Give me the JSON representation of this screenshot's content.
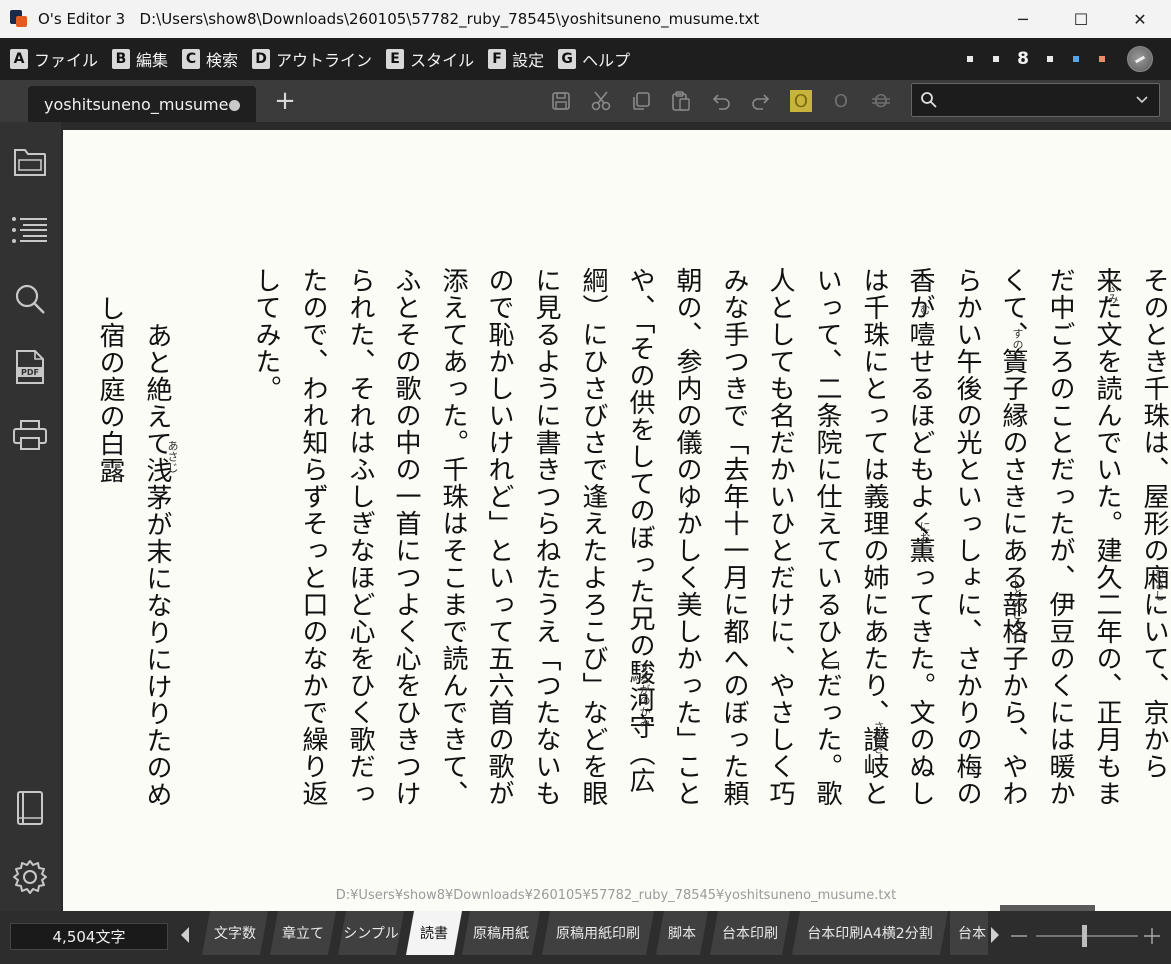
{
  "window": {
    "app_name": "O's Editor 3",
    "file_path": "D:\\Users\\show8\\Downloads\\260105\\57782_ruby_78545\\yoshitsuneno_musume.txt",
    "minimize": "─",
    "maximize": "☐",
    "close": "✕"
  },
  "menu": {
    "items": [
      {
        "key": "A",
        "label": "ファイル"
      },
      {
        "key": "B",
        "label": "編集"
      },
      {
        "key": "C",
        "label": "検索"
      },
      {
        "key": "D",
        "label": "アウトライン"
      },
      {
        "key": "E",
        "label": "スタイル"
      },
      {
        "key": "F",
        "label": "設定"
      },
      {
        "key": "G",
        "label": "ヘルプ"
      }
    ],
    "right_number": "8"
  },
  "tabs": {
    "active_tab_label": "yoshitsuneno_musume",
    "new_tab": "+"
  },
  "toolbar": {
    "icons": [
      "save-icon",
      "cut-icon",
      "copy-icon",
      "paste-icon",
      "undo-icon",
      "redo-icon",
      "bold-icon",
      "italic-icon",
      "strikethrough-icon"
    ],
    "search_placeholder": ""
  },
  "sidebar": {
    "icons": [
      "folder-icon",
      "outline-list-icon",
      "search-icon",
      "pdf-icon",
      "print-icon",
      "book-icon",
      "settings-icon"
    ]
  },
  "editor": {
    "columns": [
      "そのとき千珠は、屋形の廂にいて、京から",
      "来た文を読んでいた。建久二年の、正月もま",
      "だ中ごろのことだったが、伊豆のくには暖か",
      "くて、簀子縁のさきにある蔀格子から、やわ",
      "らかい午後の光といっしょに、さかりの梅の",
      "香が噎せるほどもよく薫ってきた。文のぬし",
      "は千珠にとっては義理の姉にあたり、讃岐と",
      "いって、二条院に仕えているひとだった。歌",
      "人としても名だかいひとだけに、やさしく巧",
      "みな手つきで「去年十一月に都へのぼった頼",
      "朝の、参内の儀のゆかしく美しかった」こと",
      "や、「その供をしてのぼった兄の駿河守（広",
      "綱）にひさびさで逢えたよろこび」などを眼",
      "に見るように書きつらねたうえ「つたないも",
      "ので恥かしいけれど」といって五六首の歌が",
      "添えてあった。千珠はそこまで読んできて、",
      "ふとその歌の中の一首につよく心をひきつけ",
      "られた、それはふしぎなほど心をひく歌だっ",
      "たので、われ知らずそっと口のなかで繰り返",
      "してみた。",
      "",
      "　あと絶えて浅茅が末になりにけりたのめ",
      "し宿の庭の白露"
    ],
    "ruby": [
      {
        "text": "ひさし"
      },
      {
        "text": "ふみ"
      },
      {
        "text": "すのこ"
      },
      {
        "text": "しとみごうし"
      },
      {
        "text": "む"
      },
      {
        "text": "にお"
      },
      {
        "text": "さぬき"
      },
      {
        "text": "するがのかみ"
      },
      {
        "text": "あさじ"
      }
    ],
    "footer_path": "D:¥Users¥show8¥Downloads¥260105¥57782_ruby_78545¥yoshitsuneno_musume.txt"
  },
  "statusbar": {
    "char_count": "4,504文字",
    "modes": [
      {
        "label": "文字数",
        "active": false
      },
      {
        "label": "章立て",
        "active": false
      },
      {
        "label": "シンプル",
        "active": false
      },
      {
        "label": "読書",
        "active": true
      },
      {
        "label": "原稿用紙",
        "active": false
      },
      {
        "label": "原稿用紙印刷",
        "active": false
      },
      {
        "label": "脚本",
        "active": false
      },
      {
        "label": "台本印刷",
        "active": false
      },
      {
        "label": "台本印刷A4横2分割",
        "active": false
      },
      {
        "label": "台本",
        "active": false
      }
    ]
  },
  "colors": {
    "menubar_bg": "#1e1e1e",
    "editor_bg": "#fbfcf6",
    "accent_highlight": "#c8b43c"
  }
}
